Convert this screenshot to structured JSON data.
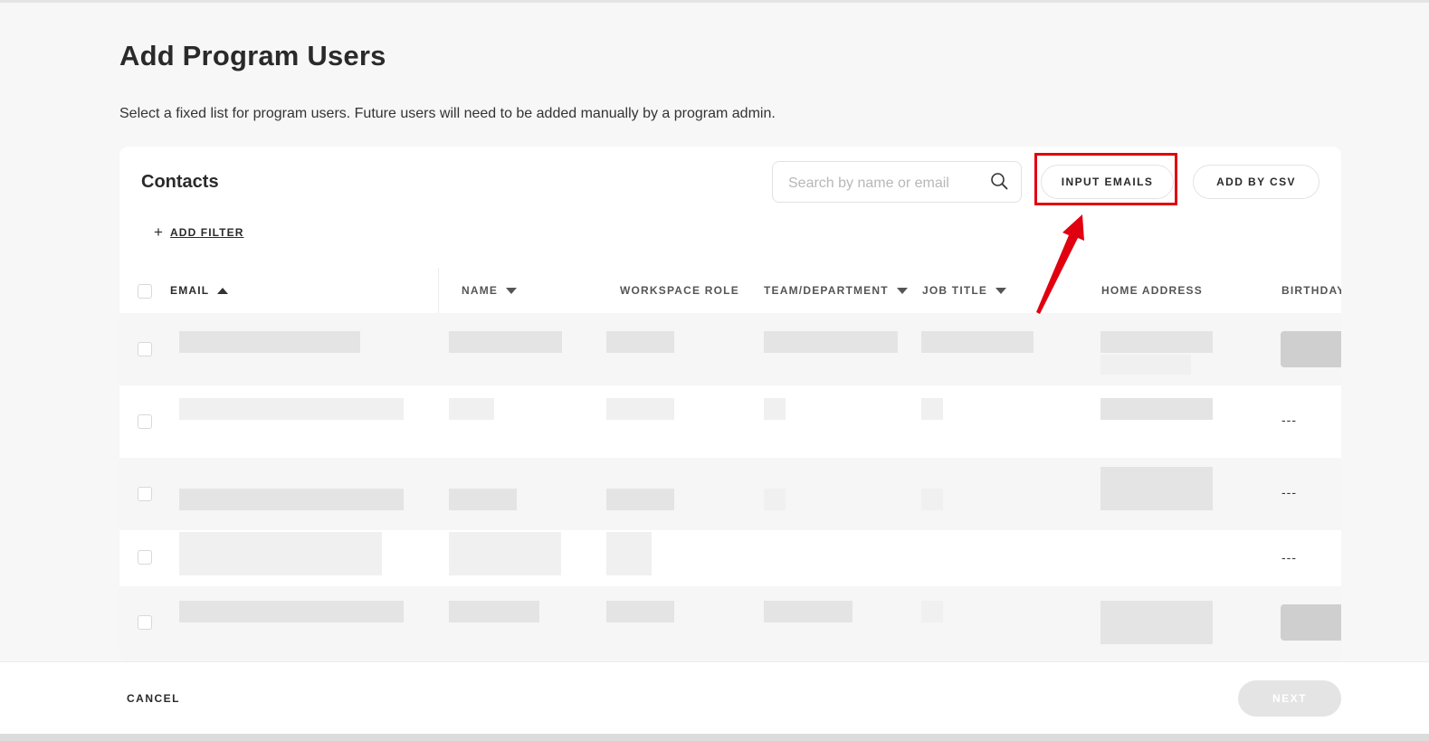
{
  "page": {
    "title": "Add Program Users",
    "description": "Select a fixed list for program users. Future users will need to be added manually by a program admin."
  },
  "contacts": {
    "title": "Contacts",
    "search": {
      "placeholder": "Search by name or email",
      "icon": "search-icon"
    },
    "input_emails_label": "INPUT EMAILS",
    "add_by_csv_label": "ADD BY CSV",
    "add_filter_label": "ADD FILTER",
    "add_filter_icon": "plus-icon"
  },
  "table": {
    "columns": [
      {
        "label": "EMAIL",
        "sort": "asc"
      },
      {
        "label": "NAME",
        "sort": "desc"
      },
      {
        "label": "WORKSPACE ROLE",
        "sort": "none"
      },
      {
        "label": "TEAM/DEPARTMENT",
        "sort": "desc"
      },
      {
        "label": "JOB TITLE",
        "sort": "desc"
      },
      {
        "label": "HOME ADDRESS",
        "sort": "none"
      },
      {
        "label": "BIRTHDAY",
        "sort": "none"
      }
    ],
    "rows": [
      {
        "birthday": ""
      },
      {
        "birthday": "---"
      },
      {
        "birthday": "---"
      },
      {
        "birthday": "---"
      },
      {
        "birthday": ""
      }
    ]
  },
  "footer": {
    "cancel_label": "CANCEL",
    "next_label": "NEXT"
  },
  "colors": {
    "highlight": "#e0000f",
    "background": "#f7f7f7",
    "card": "#ffffff",
    "disabled_button": "#e4e4e4"
  }
}
